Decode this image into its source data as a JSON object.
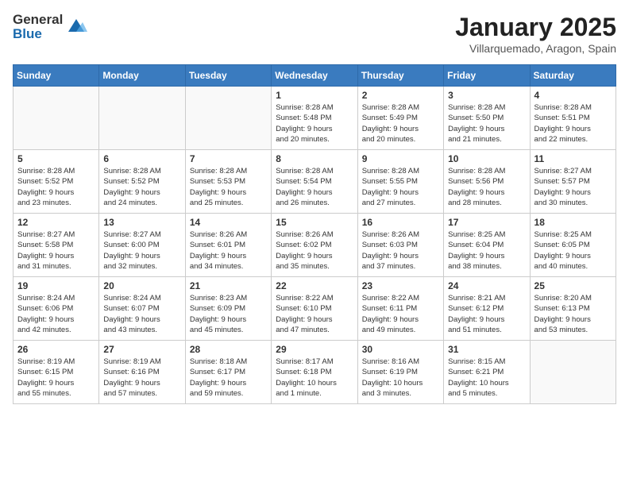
{
  "logo": {
    "general": "General",
    "blue": "Blue"
  },
  "header": {
    "month_title": "January 2025",
    "location": "Villarquemado, Aragon, Spain"
  },
  "weekdays": [
    "Sunday",
    "Monday",
    "Tuesday",
    "Wednesday",
    "Thursday",
    "Friday",
    "Saturday"
  ],
  "weeks": [
    [
      {
        "day": "",
        "info": ""
      },
      {
        "day": "",
        "info": ""
      },
      {
        "day": "",
        "info": ""
      },
      {
        "day": "1",
        "info": "Sunrise: 8:28 AM\nSunset: 5:48 PM\nDaylight: 9 hours\nand 20 minutes."
      },
      {
        "day": "2",
        "info": "Sunrise: 8:28 AM\nSunset: 5:49 PM\nDaylight: 9 hours\nand 20 minutes."
      },
      {
        "day": "3",
        "info": "Sunrise: 8:28 AM\nSunset: 5:50 PM\nDaylight: 9 hours\nand 21 minutes."
      },
      {
        "day": "4",
        "info": "Sunrise: 8:28 AM\nSunset: 5:51 PM\nDaylight: 9 hours\nand 22 minutes."
      }
    ],
    [
      {
        "day": "5",
        "info": "Sunrise: 8:28 AM\nSunset: 5:52 PM\nDaylight: 9 hours\nand 23 minutes."
      },
      {
        "day": "6",
        "info": "Sunrise: 8:28 AM\nSunset: 5:52 PM\nDaylight: 9 hours\nand 24 minutes."
      },
      {
        "day": "7",
        "info": "Sunrise: 8:28 AM\nSunset: 5:53 PM\nDaylight: 9 hours\nand 25 minutes."
      },
      {
        "day": "8",
        "info": "Sunrise: 8:28 AM\nSunset: 5:54 PM\nDaylight: 9 hours\nand 26 minutes."
      },
      {
        "day": "9",
        "info": "Sunrise: 8:28 AM\nSunset: 5:55 PM\nDaylight: 9 hours\nand 27 minutes."
      },
      {
        "day": "10",
        "info": "Sunrise: 8:28 AM\nSunset: 5:56 PM\nDaylight: 9 hours\nand 28 minutes."
      },
      {
        "day": "11",
        "info": "Sunrise: 8:27 AM\nSunset: 5:57 PM\nDaylight: 9 hours\nand 30 minutes."
      }
    ],
    [
      {
        "day": "12",
        "info": "Sunrise: 8:27 AM\nSunset: 5:58 PM\nDaylight: 9 hours\nand 31 minutes."
      },
      {
        "day": "13",
        "info": "Sunrise: 8:27 AM\nSunset: 6:00 PM\nDaylight: 9 hours\nand 32 minutes."
      },
      {
        "day": "14",
        "info": "Sunrise: 8:26 AM\nSunset: 6:01 PM\nDaylight: 9 hours\nand 34 minutes."
      },
      {
        "day": "15",
        "info": "Sunrise: 8:26 AM\nSunset: 6:02 PM\nDaylight: 9 hours\nand 35 minutes."
      },
      {
        "day": "16",
        "info": "Sunrise: 8:26 AM\nSunset: 6:03 PM\nDaylight: 9 hours\nand 37 minutes."
      },
      {
        "day": "17",
        "info": "Sunrise: 8:25 AM\nSunset: 6:04 PM\nDaylight: 9 hours\nand 38 minutes."
      },
      {
        "day": "18",
        "info": "Sunrise: 8:25 AM\nSunset: 6:05 PM\nDaylight: 9 hours\nand 40 minutes."
      }
    ],
    [
      {
        "day": "19",
        "info": "Sunrise: 8:24 AM\nSunset: 6:06 PM\nDaylight: 9 hours\nand 42 minutes."
      },
      {
        "day": "20",
        "info": "Sunrise: 8:24 AM\nSunset: 6:07 PM\nDaylight: 9 hours\nand 43 minutes."
      },
      {
        "day": "21",
        "info": "Sunrise: 8:23 AM\nSunset: 6:09 PM\nDaylight: 9 hours\nand 45 minutes."
      },
      {
        "day": "22",
        "info": "Sunrise: 8:22 AM\nSunset: 6:10 PM\nDaylight: 9 hours\nand 47 minutes."
      },
      {
        "day": "23",
        "info": "Sunrise: 8:22 AM\nSunset: 6:11 PM\nDaylight: 9 hours\nand 49 minutes."
      },
      {
        "day": "24",
        "info": "Sunrise: 8:21 AM\nSunset: 6:12 PM\nDaylight: 9 hours\nand 51 minutes."
      },
      {
        "day": "25",
        "info": "Sunrise: 8:20 AM\nSunset: 6:13 PM\nDaylight: 9 hours\nand 53 minutes."
      }
    ],
    [
      {
        "day": "26",
        "info": "Sunrise: 8:19 AM\nSunset: 6:15 PM\nDaylight: 9 hours\nand 55 minutes."
      },
      {
        "day": "27",
        "info": "Sunrise: 8:19 AM\nSunset: 6:16 PM\nDaylight: 9 hours\nand 57 minutes."
      },
      {
        "day": "28",
        "info": "Sunrise: 8:18 AM\nSunset: 6:17 PM\nDaylight: 9 hours\nand 59 minutes."
      },
      {
        "day": "29",
        "info": "Sunrise: 8:17 AM\nSunset: 6:18 PM\nDaylight: 10 hours\nand 1 minute."
      },
      {
        "day": "30",
        "info": "Sunrise: 8:16 AM\nSunset: 6:19 PM\nDaylight: 10 hours\nand 3 minutes."
      },
      {
        "day": "31",
        "info": "Sunrise: 8:15 AM\nSunset: 6:21 PM\nDaylight: 10 hours\nand 5 minutes."
      },
      {
        "day": "",
        "info": ""
      }
    ]
  ]
}
